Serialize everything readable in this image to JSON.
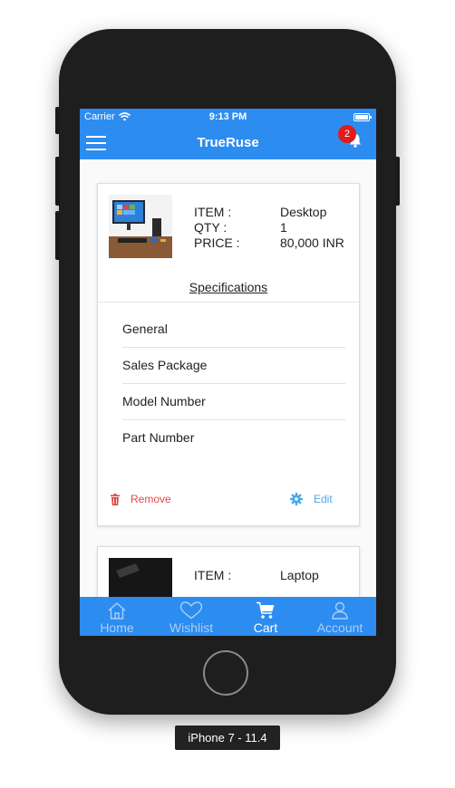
{
  "device_caption": "iPhone 7 - 11.4",
  "status_bar": {
    "carrier": "Carrier",
    "time": "9:13 PM"
  },
  "header": {
    "title": "TrueRuse",
    "notification_count": "2",
    "menu_icon": "hamburger-icon",
    "bell_icon": "bell-icon"
  },
  "cart": {
    "items": [
      {
        "item_label": "ITEM :",
        "item_value": "Desktop",
        "qty_label": "QTY :",
        "qty_value": "1",
        "price_label": "PRICE :",
        "price_value": "80,000 INR",
        "specifications_title": "Specifications",
        "specifications": [
          "General",
          "Sales Package",
          "Model Number",
          "Part Number"
        ],
        "remove_label": "Remove",
        "edit_label": "Edit"
      },
      {
        "item_label": "ITEM :",
        "item_value": "Laptop"
      }
    ]
  },
  "tabbar": {
    "tabs": [
      {
        "label": "Home",
        "icon": "home-icon"
      },
      {
        "label": "Wishlist",
        "icon": "heart-icon"
      },
      {
        "label": "Cart",
        "icon": "cart-icon"
      },
      {
        "label": "Account",
        "icon": "user-icon"
      }
    ],
    "active": "Cart"
  },
  "colors": {
    "primary": "#2d8cf0",
    "badge": "#e21b1b",
    "remove": "#e04848",
    "edit": "#4aa8e8"
  }
}
